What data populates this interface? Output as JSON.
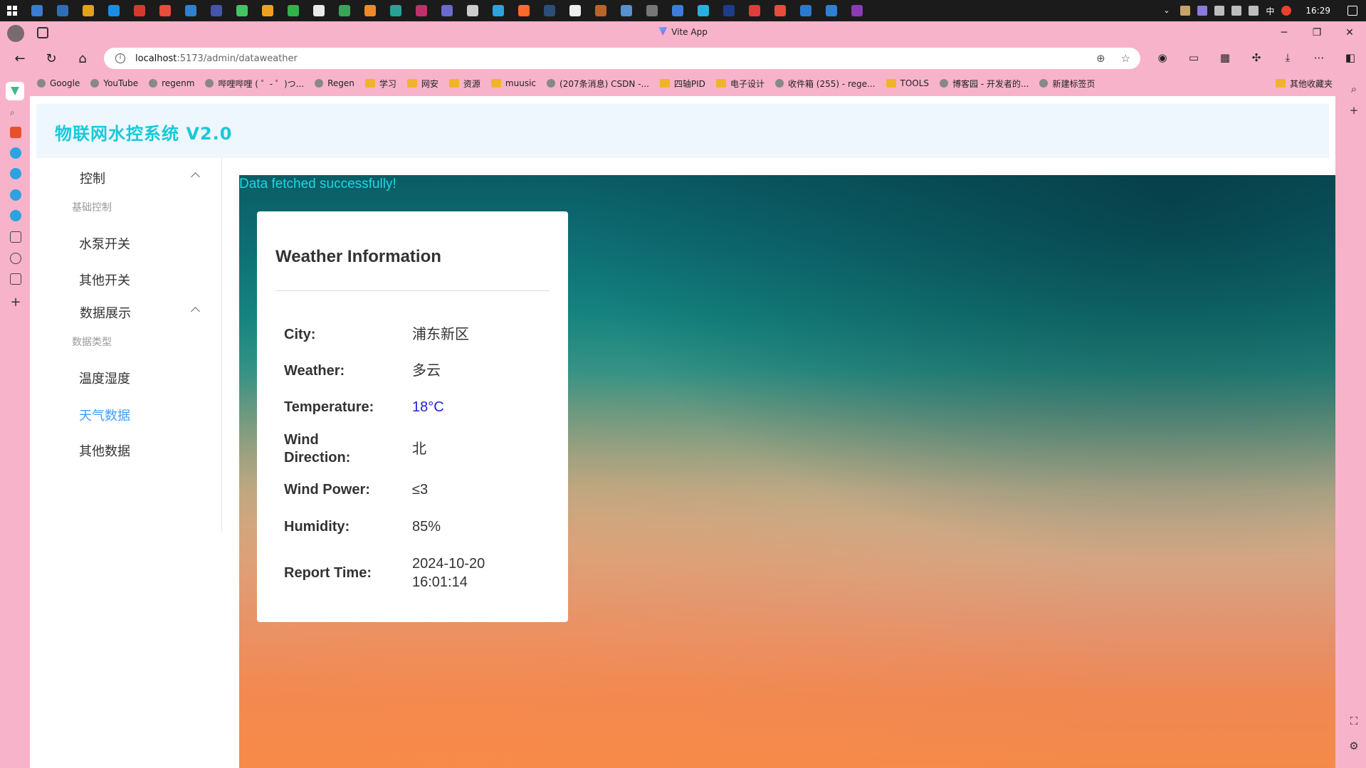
{
  "taskbar": {
    "clock": "16:29",
    "ime": "中",
    "apps": [
      "search",
      "desktop",
      "files",
      "edge",
      "wps",
      "xmind",
      "vscode",
      "jetbrains",
      "qt",
      "frame",
      "wechat",
      "doc",
      "excel",
      "ico1",
      "ico2",
      "ico3",
      "ico4",
      "ico5",
      "ico6",
      "flash",
      "steam",
      "typora",
      "ico7",
      "ico8",
      "ico9",
      "mx",
      "ico10",
      "ico11",
      "netease",
      "xmind2",
      "ico12",
      "vscode2",
      "winrar"
    ]
  },
  "browser": {
    "window_title": "Vite App",
    "url_host": "localhost",
    "url_path": ":5173/admin/dataweather",
    "bookmarks": [
      {
        "label": "Google",
        "type": "site"
      },
      {
        "label": "YouTube",
        "type": "site"
      },
      {
        "label": "regenm",
        "type": "site"
      },
      {
        "label": "哔哩哔哩 ( ゜- ゜)つ...",
        "type": "site"
      },
      {
        "label": "Regen",
        "type": "site"
      },
      {
        "label": "学习",
        "type": "folder"
      },
      {
        "label": "网安",
        "type": "folder"
      },
      {
        "label": "资源",
        "type": "folder"
      },
      {
        "label": "muusic",
        "type": "folder"
      },
      {
        "label": "(207条消息) CSDN -...",
        "type": "site"
      },
      {
        "label": "四轴PID",
        "type": "folder"
      },
      {
        "label": "电子设计",
        "type": "folder"
      },
      {
        "label": "收件箱 (255) - rege...",
        "type": "site"
      },
      {
        "label": "TOOLS",
        "type": "folder"
      },
      {
        "label": "博客园 - 开发者的...",
        "type": "site"
      },
      {
        "label": "新建标签页",
        "type": "site"
      }
    ],
    "other_bookmarks": "其他收藏夹"
  },
  "app": {
    "title": "物联网水控系统 V2.0",
    "menu": {
      "control": {
        "label": "控制",
        "group": "基础控制",
        "items": [
          "水泵开关",
          "其他开关"
        ]
      },
      "display": {
        "label": "数据展示",
        "group": "数据类型",
        "items": [
          "温度湿度",
          "天气数据",
          "其他数据"
        ]
      }
    },
    "status_message": "Data fetched successfully!",
    "weather": {
      "heading": "Weather Information",
      "city_label": "City:",
      "city": "浦东新区",
      "weather_label": "Weather:",
      "weather": "多云",
      "temperature_label": "Temperature:",
      "temperature": "18°C",
      "wind_direction_label_1": "Wind",
      "wind_direction_label_2": "Direction:",
      "wind_direction": "北",
      "wind_power_label": "Wind Power:",
      "wind_power": "≤3",
      "humidity_label": "Humidity:",
      "humidity": "85%",
      "report_time_label": "Report Time:",
      "report_date": "2024-10-20",
      "report_clock": "16:01:14"
    }
  },
  "colors": {
    "accent_title": "#18c9d9",
    "active_menu": "#409eff",
    "temperature": "#1f1fd8",
    "browser_frame": "#f7b3c9"
  }
}
